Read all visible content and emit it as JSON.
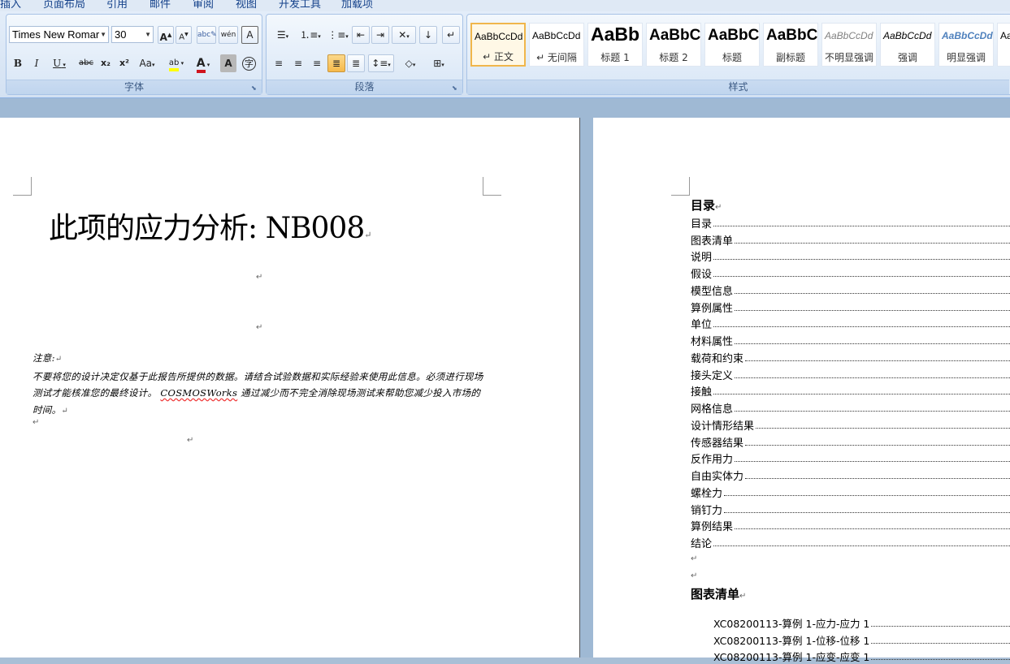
{
  "menu": [
    "插入",
    "页面布局",
    "引用",
    "邮件",
    "审阅",
    "视图",
    "开发工具",
    "加载项"
  ],
  "font_group": {
    "label": "字体",
    "font_name": "Times New Romar",
    "font_size": "30",
    "buttons": {
      "bold": "B",
      "italic": "I",
      "underline": "U",
      "strike": "abc",
      "subscript": "x₂",
      "superscript": "x²",
      "change_case": "Aa",
      "highlight": "ab",
      "font_color": "A",
      "char_shading": "A",
      "enclose": "字",
      "grow": "A",
      "shrink": "A",
      "clear": "A",
      "phonetic": "wén",
      "border": "A"
    },
    "colors": {
      "highlight": "#ffff00",
      "font_color": "#d0141e"
    }
  },
  "paragraph_group": {
    "label": "段落"
  },
  "styles_group": {
    "label": "样式",
    "tiles": [
      {
        "sample": "AaBbCcDd",
        "name": "↵ 正文",
        "selected": true
      },
      {
        "sample": "AaBbCcDd",
        "name": "↵ 无间隔"
      },
      {
        "sample": "AaBb",
        "name": "标题 1"
      },
      {
        "sample": "AaBbC",
        "name": "标题 2"
      },
      {
        "sample": "AaBbC",
        "name": "标题"
      },
      {
        "sample": "AaBbC",
        "name": "副标题"
      },
      {
        "sample": "AaBbCcDd",
        "name": "不明显强调"
      },
      {
        "sample": "AaBbCcDd",
        "name": "强调"
      },
      {
        "sample": "AaBbCcDd",
        "name": "明显强调"
      },
      {
        "sample": "Aa",
        "name": ""
      }
    ]
  },
  "doc_left": {
    "title": "此项的应力分析: NB008",
    "note_heading": "注意:",
    "note_text_1": "不要将您的设计决定仅基于此报告所提供的数据。请结合试验数据和实际经验来使用此信息。必须进行现场测试才能核准您的最终设计。",
    "note_brand": "COSMOSWorks",
    "note_text_2": "通过减少而不完全消除现场测试来帮助您减少投入市场的时间。"
  },
  "doc_right": {
    "toc_heading": "目录",
    "toc_items": [
      "目录",
      "图表清单",
      "说明",
      "假设",
      "模型信息",
      "算例属性",
      "单位",
      "材料属性",
      "载荷和约束",
      "接头定义",
      "接触",
      "网格信息",
      "设计情形结果",
      "传感器结果",
      "反作用力",
      "自由实体力",
      "螺栓力",
      "销钉力",
      "算例结果",
      "结论"
    ],
    "fig_heading": "图表清单",
    "fig_items": [
      "XC08200113-算例 1-应力-应力 1",
      "XC08200113-算例 1-位移-位移 1",
      "XC08200113-算例 1-应变-应变 1"
    ]
  }
}
